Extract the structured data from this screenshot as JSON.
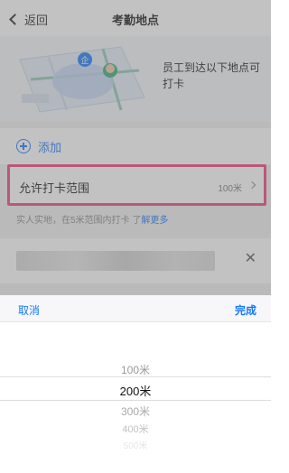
{
  "nav": {
    "back_label": "返回",
    "title": "考勤地点"
  },
  "hero": {
    "text": "员工到达以下地点可打卡"
  },
  "add": {
    "label": "添加"
  },
  "range": {
    "label": "允许打卡范围",
    "value": "100米"
  },
  "hint": {
    "text": "实人实地，在5米范围内打卡 了",
    "more": "解更多"
  },
  "picker": {
    "cancel_label": "取消",
    "done_label": "完成",
    "options": [
      "100米",
      "200米",
      "300米",
      "400米",
      "500米"
    ],
    "selected": "200米"
  },
  "colors": {
    "accent": "#1677ff",
    "highlight": "#ef3e7a"
  },
  "icons": {
    "back": "chevron-left-icon",
    "add": "plus-circle-icon",
    "arrow": "chevron-right-icon",
    "remove": "close-icon"
  }
}
